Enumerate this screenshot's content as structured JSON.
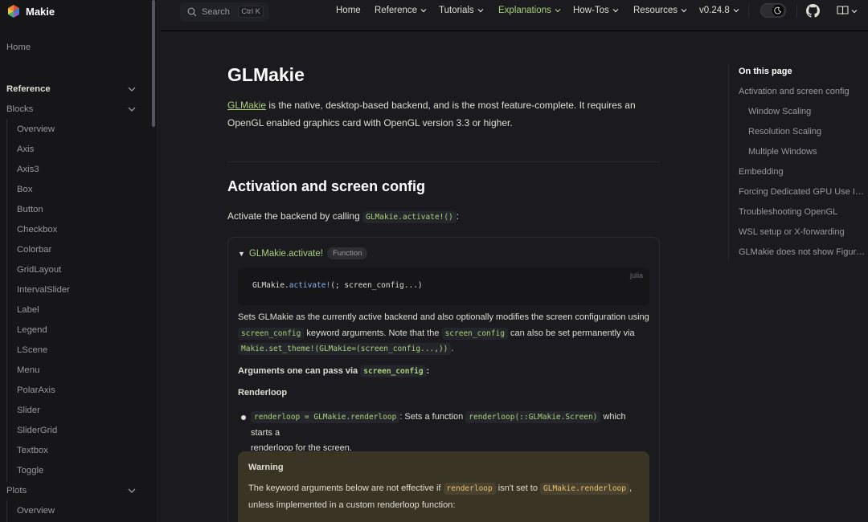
{
  "logo": {
    "text": "Makie"
  },
  "sidebar": {
    "home": "Home",
    "reference": "Reference",
    "blocks": "Blocks",
    "blocks_items": [
      "Overview",
      "Axis",
      "Axis3",
      "Box",
      "Button",
      "Checkbox",
      "Colorbar",
      "GridLayout",
      "IntervalSlider",
      "Label",
      "Legend",
      "LScene",
      "Menu",
      "PolarAxis",
      "Slider",
      "SliderGrid",
      "Textbox",
      "Toggle"
    ],
    "plots": "Plots",
    "plots_items": [
      "Overview"
    ]
  },
  "topnav": {
    "search_label": "Search",
    "search_shortcut": "Ctrl K",
    "items": [
      "Home",
      "Reference",
      "Tutorials",
      "Explanations",
      "How-Tos",
      "Resources",
      "v0.24.8"
    ]
  },
  "main": {
    "title": "GLMakie",
    "intro_link": "GLMakie",
    "intro_line1_rest": " is the native, desktop-based backend, and is the most feature-complete. It requires an",
    "intro_line2": "OpenGL enabled graphics card with OpenGL version 3.3 or higher.",
    "h2": "Activation and screen config",
    "activate_text": "Activate the backend by calling ",
    "activate_code": "GLMakie.activate!()",
    "activate_end": ":"
  },
  "docstring": {
    "name": "GLMakie.activate!",
    "badge": "Function",
    "code_lang": "julia",
    "code_prefix": "GLMakie.",
    "code_fn": "activate!",
    "code_suffix": "(; screen_config...)",
    "p1_text": "Sets GLMakie as the currently active backend and also optionally modifies the screen configuration using",
    "p1_code1": "screen_config",
    "p1_mid": " keyword arguments. Note that the ",
    "p1_code2": "screen_config",
    "p1_end": " can also be set permanently via",
    "p1_code3": "Makie.set_theme!(GLMakie=(screen_config...,))",
    "p1_dot": ".",
    "args_text": "Arguments one can pass via ",
    "args_code": "screen_config",
    "args_end": ":",
    "renderloop_heading": "Renderloop",
    "bullet_code1": "renderloop = GLMakie.renderloop",
    "bullet_text1": ": Sets a function ",
    "bullet_code2": "renderloop(::GLMakie.Screen)",
    "bullet_text2": " which starts a",
    "bullet_line2": "renderloop for the screen.",
    "warning_title": "Warning",
    "warning_text1": "The keyword arguments below are not effective if ",
    "warning_code1": "renderloop",
    "warning_text2": " isn't set to ",
    "warning_code2": "GLMakie.renderloop",
    "warning_text3": ",",
    "warning_line2": "unless implemented in a custom renderloop function:"
  },
  "toc": {
    "title": "On this page",
    "items": [
      "Activation and screen config",
      "Window Scaling",
      "Resolution Scaling",
      "Multiple Windows",
      "Embedding",
      "Forcing Dedicated GPU Use In L...",
      "Troubleshooting OpenGL",
      "WSL setup or X-forwarding",
      "GLMakie does not show Figure ..."
    ]
  },
  "colors": {
    "accent": "#a8d17a",
    "background": "#1b1b1f",
    "warning_bg": "#3a3424"
  }
}
